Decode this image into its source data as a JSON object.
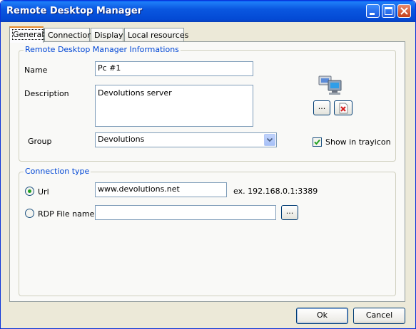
{
  "window": {
    "title": "Remote Desktop Manager"
  },
  "tabs": [
    {
      "label": "General"
    },
    {
      "label": "Connection"
    },
    {
      "label": "Display"
    },
    {
      "label": "Local resources"
    }
  ],
  "info_group": {
    "title": "Remote Desktop Manager Informations",
    "name_label": "Name",
    "name_value": "Pc #1",
    "description_label": "Description",
    "description_value": "Devolutions server",
    "group_label": "Group",
    "group_value": "Devolutions",
    "icon_browse_label": "...",
    "show_trayicon_label": "Show in trayicon",
    "show_trayicon_checked": true
  },
  "connection_group": {
    "title": "Connection type",
    "url_label": "Url",
    "url_value": "www.devolutions.net",
    "url_example": "ex. 192.168.0.1:3389",
    "rdp_label": "RDP File name",
    "rdp_value": "",
    "rdp_browse_label": "...",
    "selected": "url"
  },
  "footer": {
    "ok_label": "Ok",
    "cancel_label": "Cancel"
  }
}
